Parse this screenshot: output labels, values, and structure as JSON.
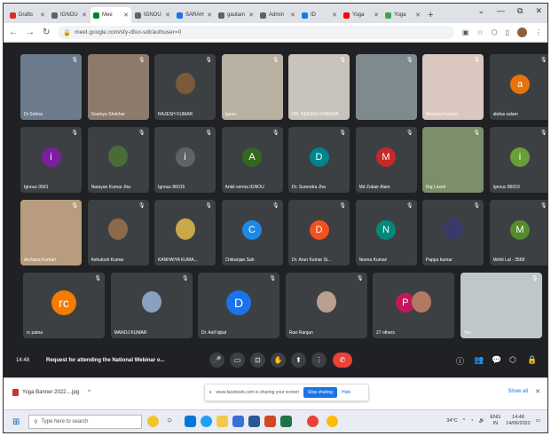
{
  "browser": {
    "tabs": [
      {
        "label": "Drafts",
        "color": "#d93025"
      },
      {
        "label": "IGNOU",
        "color": "#5f6368"
      },
      {
        "label": "Mee",
        "color": "#00832d",
        "active": true
      },
      {
        "label": "IGNOU",
        "color": "#5f6368"
      },
      {
        "label": "SARAH",
        "color": "#1a73e8"
      },
      {
        "label": "gautam",
        "color": "#5f6368"
      },
      {
        "label": "Admin",
        "color": "#5f6368"
      },
      {
        "label": "ID",
        "color": "#1877f2"
      },
      {
        "label": "Yoga",
        "color": "#ff0000"
      },
      {
        "label": "Yoga",
        "color": "#34a853"
      }
    ],
    "new_tab": "+",
    "window_controls": [
      "⌄",
      "—",
      "⧉",
      "✕"
    ],
    "url": "meet.google.com/sfy-dfoo-sdt/authuser=0"
  },
  "participants": [
    {
      "name": "Dr.Sohna",
      "kind": "video",
      "bg": "#6b7b8c",
      "selected": true
    },
    {
      "name": "Soumya Shekhar",
      "kind": "video",
      "bg": "#8c7a6b"
    },
    {
      "name": "RAJESH KUMAR",
      "kind": "photo",
      "bg": "#3c4043",
      "photo": "#7a5a3a"
    },
    {
      "name": "Ignou",
      "kind": "video",
      "bg": "#b8b0a0"
    },
    {
      "name": "DR. NEERAJ SHARMA",
      "kind": "video",
      "bg": "#c9c4bb"
    },
    {
      "name": "",
      "kind": "video",
      "bg": "#7f8a8f"
    },
    {
      "name": "Munisha Kumari",
      "kind": "video",
      "bg": "#d9c7c0"
    },
    {
      "name": "abdus salam",
      "kind": "initial",
      "initial": "a",
      "color": "#e8710a"
    },
    {
      "name": "Ignouc 0561",
      "kind": "initial",
      "initial": "i",
      "color": "#7b1fa2"
    },
    {
      "name": "Narayan Kumar Jha",
      "kind": "photo",
      "bg": "#3c4043",
      "photo": "#4a6a3a"
    },
    {
      "name": "Ignouc 86015",
      "kind": "initial",
      "initial": "i",
      "color": "#5f6368"
    },
    {
      "name": "Ankit verma IGNOU",
      "kind": "initial",
      "initial": "A",
      "color": "#33691e"
    },
    {
      "name": "Dr. Surendra Jha",
      "kind": "initial",
      "initial": "D",
      "color": "#00838f"
    },
    {
      "name": "Md Zubair Alam",
      "kind": "initial",
      "initial": "M",
      "color": "#c62828"
    },
    {
      "name": "Raj Laxmi",
      "kind": "video",
      "bg": "#7a8f6a"
    },
    {
      "name": "Ignouc 86010",
      "kind": "initial",
      "initial": "i",
      "color": "#689f38"
    },
    {
      "name": "Archana Kumari",
      "kind": "video",
      "bg": "#b79d7d"
    },
    {
      "name": "Ashutosh Kumar",
      "kind": "photo",
      "bg": "#3c4043",
      "photo": "#8a6a4a"
    },
    {
      "name": "KANHAIYA KUMA...",
      "kind": "photo",
      "bg": "#3c4043",
      "photo": "#c9a84a"
    },
    {
      "name": "Chitranjan Sah",
      "kind": "initial",
      "initial": "C",
      "color": "#1e88e5"
    },
    {
      "name": "Dr. Arun Kumar Si...",
      "kind": "initial",
      "initial": "D",
      "color": "#f4511e"
    },
    {
      "name": "Neena Kumari",
      "kind": "initial",
      "initial": "N",
      "color": "#00897b"
    },
    {
      "name": "Pappu kumar",
      "kind": "photo",
      "bg": "#3c4043",
      "photo": "#3a3a6a"
    },
    {
      "name": "Mohit Lal - 3568",
      "kind": "initial",
      "initial": "M",
      "color": "#558b2f"
    }
  ],
  "last_row": [
    {
      "name": "rc patna",
      "kind": "initial",
      "initial": "rc",
      "color": "#f57c00"
    },
    {
      "name": "MANOJ KUMAR",
      "kind": "photo",
      "bg": "#3c4043",
      "photo": "#8aa0c0"
    },
    {
      "name": "Dr. Asif Iqbal",
      "kind": "initial",
      "initial": "D",
      "color": "#1a73e8"
    },
    {
      "name": "Ravi Ranjan",
      "kind": "photo",
      "bg": "#3c4043",
      "photo": "#b9a090"
    },
    {
      "name": "27 others",
      "kind": "others"
    },
    {
      "name": "You",
      "kind": "self",
      "bg": "#bfc7c9"
    }
  ],
  "others_initial": "P",
  "meeting": {
    "time": "14:48",
    "title": "Request for attending the National Webinar o..."
  },
  "controls": [
    "🎤",
    "▭",
    "⊡",
    "✋",
    "⬆",
    "⋮"
  ],
  "end_call": "✆",
  "right_controls": [
    "ⓘ",
    "👥",
    "💬",
    "⬡",
    "🔒"
  ],
  "download": {
    "file": "Yoga Banner 2022....jpg",
    "chevron": "^",
    "show_all": "Show all",
    "close": "✕"
  },
  "share_notice": {
    "text": "www.facebook.com is sharing your screen",
    "stop": "Stop sharing",
    "hide": "Hide"
  },
  "taskbar": {
    "search_placeholder": "Type here to search",
    "weather": "34°C",
    "lang": "ENG",
    "region": "IN",
    "time": "14:48",
    "date": "14/06/2022"
  }
}
